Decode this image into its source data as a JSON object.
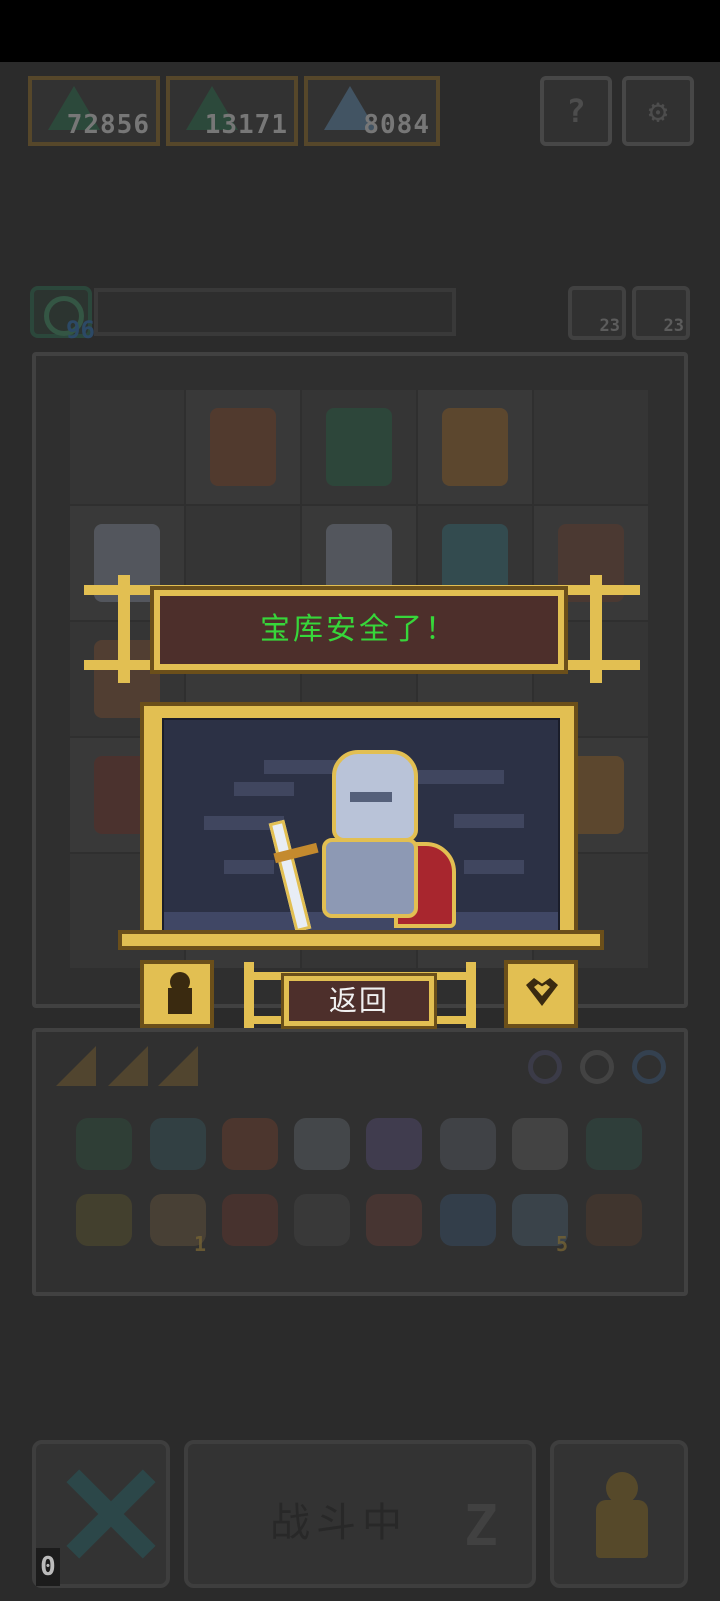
{
  "currencies": [
    {
      "icon": "tree-icon",
      "value": "72856"
    },
    {
      "icon": "tree-icon",
      "value": "13171"
    },
    {
      "icon": "dragon-icon",
      "value": "8084"
    }
  ],
  "top_buttons": {
    "help": "?",
    "settings": "gear-icon"
  },
  "level": {
    "value": "96"
  },
  "side_counts": {
    "scroll": "23",
    "key": "23"
  },
  "modal": {
    "title": "宝库安全了！",
    "return_label": "返回"
  },
  "inventory": {
    "star_count": "1",
    "orb_count": "5"
  },
  "bottom": {
    "battle_label": "战斗中",
    "sleep_label": "Z",
    "queue_count": "0"
  },
  "colors": {
    "gold": "#e2bf52",
    "banner_bg": "#4d2f2b",
    "title_green": "#37d63a",
    "background": "#2b2b2b"
  }
}
